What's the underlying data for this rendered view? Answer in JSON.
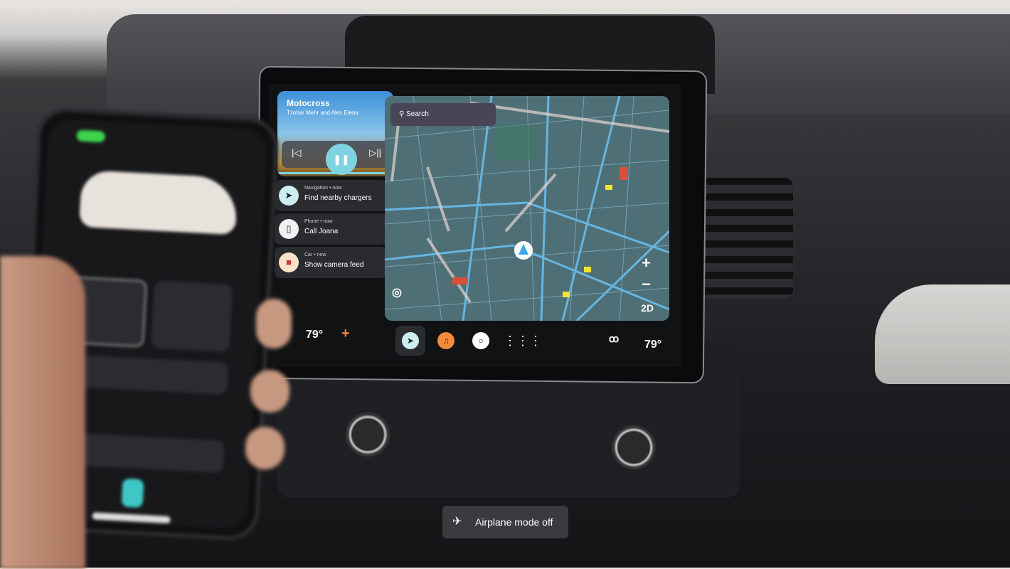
{
  "media": {
    "title": "Motocross",
    "artist": "Tzohar Mehr and Alex Elena",
    "prev_icon": "skip-previous-icon",
    "pause_icon": "pause-icon",
    "next_icon": "skip-next-icon",
    "progress_percent": 100
  },
  "notifications": [
    {
      "source": "Navigation • now",
      "message": "Find nearby chargers",
      "icon": "navigation-arrow-icon",
      "icon_bg": "#cdeef0"
    },
    {
      "source": "Phone • now",
      "message": "Call Joana",
      "icon": "phone-icon",
      "icon_bg": "#f1f1f1"
    },
    {
      "source": "Car • now",
      "message": "Show camera feed",
      "icon": "camera-icon",
      "icon_bg": "#f6e3c8"
    }
  ],
  "map": {
    "search_placeholder": "Search",
    "zoom_in": "+",
    "zoom_out": "−",
    "view_mode": "2D"
  },
  "bottom_bar": {
    "left_temp": "79°",
    "right_temp": "79°",
    "fan_icon": "+",
    "apps": [
      {
        "name": "navigation",
        "icon": "navigation-arrow-icon",
        "color": "#cdeef0"
      },
      {
        "name": "music",
        "icon": "music-note-icon",
        "color": "#f28a3c"
      },
      {
        "name": "assistant",
        "icon": "circle-icon",
        "color": "#ffffff"
      },
      {
        "name": "app-launcher",
        "icon": "grid-icon",
        "color": "#ffffff"
      }
    ],
    "climate_icon": "fan-off-icon"
  },
  "toast": {
    "text": "Airplane mode off",
    "icon": "airplane-off-icon"
  }
}
